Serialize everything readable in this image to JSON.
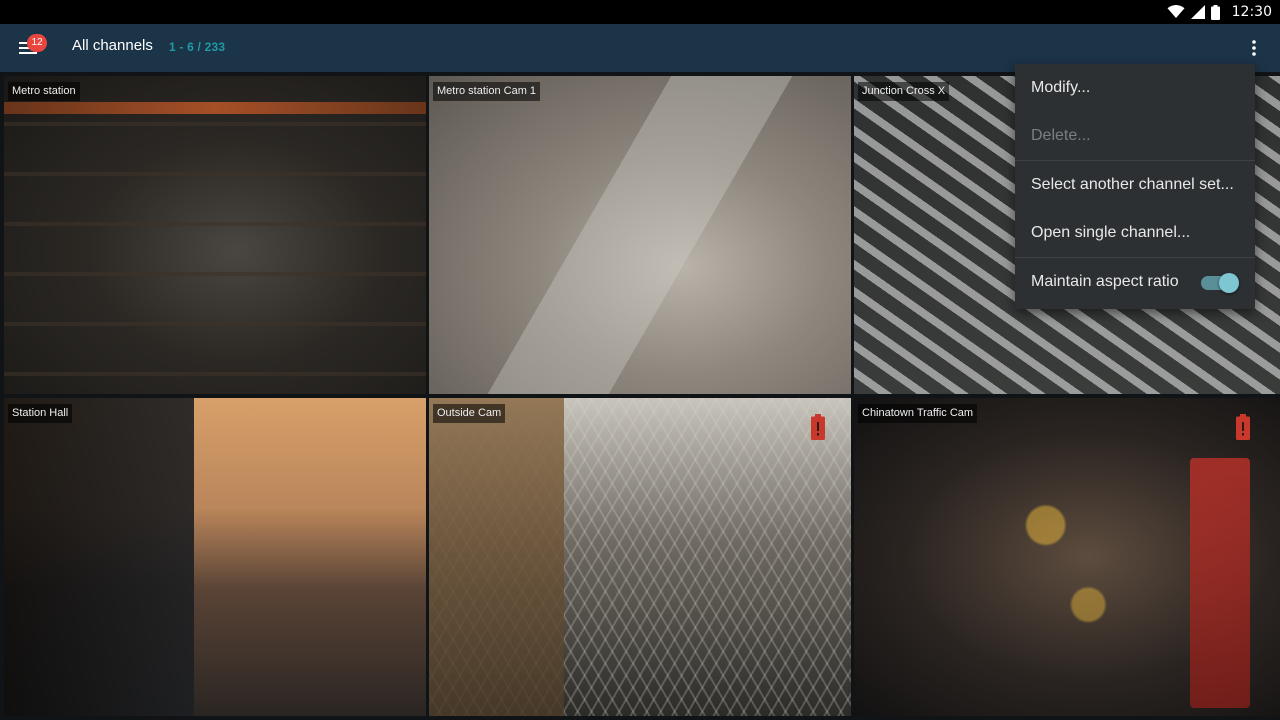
{
  "status_bar": {
    "time": "12:30",
    "icons": [
      "wifi-icon",
      "signal-icon",
      "battery-icon"
    ]
  },
  "app_bar": {
    "title": "All channels",
    "range": "1 - 6 / 233",
    "notification_count": "12",
    "menu_icon": "hamburger-icon",
    "more_icon": "more-vert-icon"
  },
  "channels": [
    {
      "label": "Metro station",
      "alert": false
    },
    {
      "label": "Metro station Cam 1",
      "alert": false
    },
    {
      "label": "Junction Cross X",
      "alert": false
    },
    {
      "label": "Station Hall",
      "alert": false
    },
    {
      "label": "Outside Cam",
      "alert": true
    },
    {
      "label": "Chinatown Traffic Cam",
      "alert": true
    }
  ],
  "overflow_menu": {
    "items": [
      {
        "label": "Modify...",
        "enabled": true
      },
      {
        "label": "Delete...",
        "enabled": false
      },
      {
        "label": "Select another channel set...",
        "enabled": true
      },
      {
        "label": "Open single channel...",
        "enabled": true
      },
      {
        "label": "Maintain aspect ratio",
        "enabled": true,
        "toggle": true,
        "checked": true
      }
    ]
  },
  "colors": {
    "app_bar": "#1c3447",
    "accent": "#1f9aa6",
    "badge": "#e8463e",
    "alert": "#c8382b",
    "menu_bg": "#2d3033"
  }
}
